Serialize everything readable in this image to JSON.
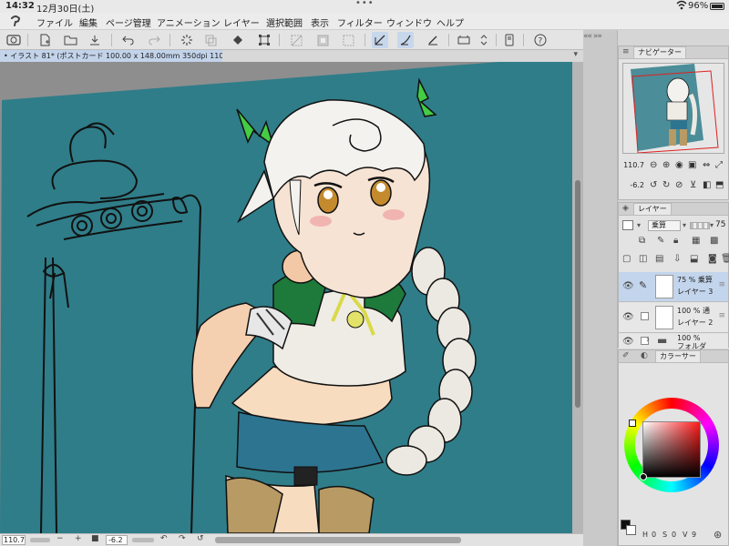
{
  "status": {
    "time": "14:32",
    "date": "12月30日(土)",
    "dots": "•••",
    "battery": "96%"
  },
  "menu": {
    "items": [
      "ファイル",
      "編集",
      "ページ管理",
      "アニメーション",
      "レイヤー",
      "選択範囲",
      "表示",
      "フィルター",
      "ウィンドウ",
      "ヘルプ"
    ]
  },
  "canvas": {
    "tab_title": "• イラスト 81* (ポストカード 100.00 x 148.00mm 350dpi 110.7%)",
    "bg_color": "#2f7d89"
  },
  "bottom": {
    "zoom": "110.7",
    "rotation": "-6.2",
    "minus": "−",
    "plus": "+"
  },
  "navigator": {
    "title": "ナビゲーター",
    "zoom": "110.7",
    "rotation": "-6.2"
  },
  "layers": {
    "title": "レイヤー",
    "blend_mode": "乗算",
    "opacity": "75",
    "rows": [
      {
        "opacity": "75 %",
        "mode": "乗算",
        "name": "レイヤー 3"
      },
      {
        "opacity": "100 %",
        "mode": "通",
        "name": "レイヤー 2"
      },
      {
        "opacity": "100 %",
        "mode": "",
        "name": "フォルダ"
      }
    ]
  },
  "color": {
    "title": "カラーサー",
    "main_color": "#111111",
    "footer": [
      "H",
      "0",
      "S",
      "0",
      "V",
      "9"
    ]
  }
}
